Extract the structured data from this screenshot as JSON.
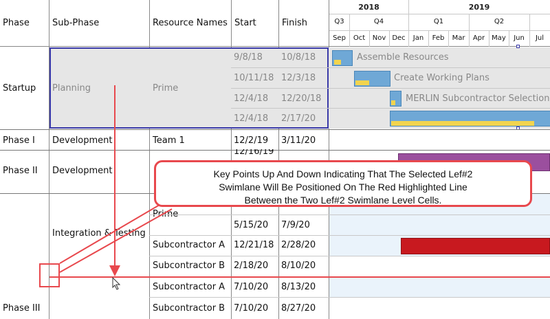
{
  "columns": {
    "phase": "Phase",
    "sub_phase": "Sub-Phase",
    "resource": "Resource Names",
    "start": "Start",
    "finish": "Finish"
  },
  "timeline": {
    "years": [
      "2018",
      "2019"
    ],
    "quarters": [
      "Q3",
      "Q4",
      "Q1",
      "Q2"
    ],
    "months": [
      "Sep",
      "Oct",
      "Nov",
      "Dec",
      "Jan",
      "Feb",
      "Mar",
      "Apr",
      "May",
      "Jun",
      "Jul"
    ]
  },
  "rows": {
    "startup": {
      "phase": "Startup",
      "sub_phase": "Planning",
      "resource": "Prime",
      "tasks": [
        {
          "start": "9/8/18",
          "finish": "10/8/18",
          "label": "Assemble Resources"
        },
        {
          "start": "10/11/18",
          "finish": "12/3/18",
          "label": "Create Working Plans"
        },
        {
          "start": "12/4/18",
          "finish": "12/20/18",
          "label": "MERLIN Subcontractor Selection"
        },
        {
          "start": "12/4/18",
          "finish": "2/17/20",
          "label": ""
        }
      ]
    },
    "phase1": {
      "phase": "Phase I",
      "sub_phase": "Development",
      "resource": "Team 1",
      "start": "12/2/19",
      "finish": "3/11/20"
    },
    "phase2": {
      "phase": "Phase II",
      "sub_phase": "Development",
      "start_partial": "12/16/19"
    },
    "phase3": {
      "phase": "Phase III",
      "sub_phase": "Integration & Testing",
      "tasks": [
        {
          "resource": "Prime",
          "start": "",
          "finish": ""
        },
        {
          "resource": "",
          "start": "5/15/20",
          "finish": "7/9/20"
        },
        {
          "resource": "Subcontractor A",
          "start": "12/21/18",
          "finish": "2/28/20"
        },
        {
          "resource": "Subcontractor B",
          "start": "2/18/20",
          "finish": "8/10/20"
        },
        {
          "resource": "Subcontractor A",
          "start": "7/10/20",
          "finish": "8/13/20"
        },
        {
          "resource": "Subcontractor B",
          "start": "7/10/20",
          "finish": "8/27/20"
        }
      ]
    }
  },
  "callout": {
    "line1": "Key Points Up And Down Indicating That The Selected Lef#2",
    "line2": "Swimlane Will Be Positioned On The Red Highlighted Line",
    "line3": "Between the Two Lef#2 Swimlane Level Cells."
  },
  "colors": {
    "selection": "#3a3aa8",
    "task_blue": "#6fa8d6",
    "progress_yellow": "#f2d44e",
    "phase2_bar": "#9b4f9e",
    "subA_bar": "#c8191f",
    "insert_line": "#e8484d"
  }
}
